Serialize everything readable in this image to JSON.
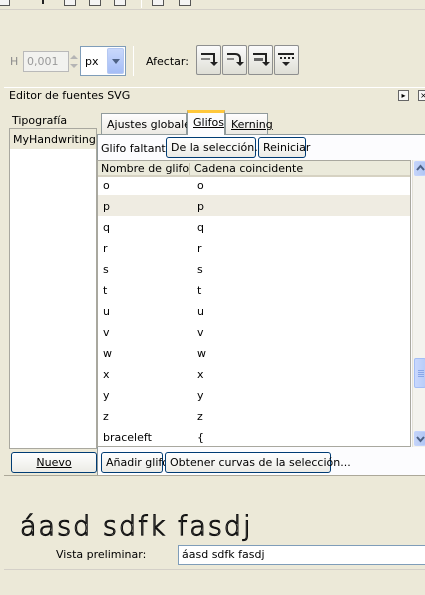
{
  "toolbar": {
    "h_label": "H",
    "h_value": "0,001",
    "unit": "px",
    "affect_label": "Afectar:"
  },
  "panel": {
    "title": "Editor de fuentes SVG"
  },
  "fonts": {
    "header": "Tipografía",
    "items": [
      "MyHandwriting"
    ],
    "new_button": "Nuevo"
  },
  "tabs": [
    {
      "label": "Ajustes globales"
    },
    {
      "label": "Glifos"
    },
    {
      "label": "Kerning"
    }
  ],
  "glyphs": {
    "missing_label": "Glifo faltante:",
    "from_selection_button": "De la selección...",
    "reset_button": "Reiniciar",
    "columns": [
      "Nombre de glifo",
      "Cadena coincidente"
    ],
    "rows": [
      {
        "name": "o",
        "string": "o"
      },
      {
        "name": "p",
        "string": "p"
      },
      {
        "name": "q",
        "string": "q"
      },
      {
        "name": "r",
        "string": "r"
      },
      {
        "name": "s",
        "string": "s"
      },
      {
        "name": "t",
        "string": "t"
      },
      {
        "name": "u",
        "string": "u"
      },
      {
        "name": "v",
        "string": "v"
      },
      {
        "name": "w",
        "string": "w"
      },
      {
        "name": "x",
        "string": "x"
      },
      {
        "name": "y",
        "string": "y"
      },
      {
        "name": "z",
        "string": "z"
      },
      {
        "name": "braceleft",
        "string": "{"
      }
    ],
    "add_glyph_button": "Añadir glifo",
    "get_curves_button": "Obtener curvas de la selección..."
  },
  "preview": {
    "sample_text": "áasd sdfk fasdj",
    "label": "Vista preliminar:",
    "input_value": "áasd sdfk fasdj"
  }
}
